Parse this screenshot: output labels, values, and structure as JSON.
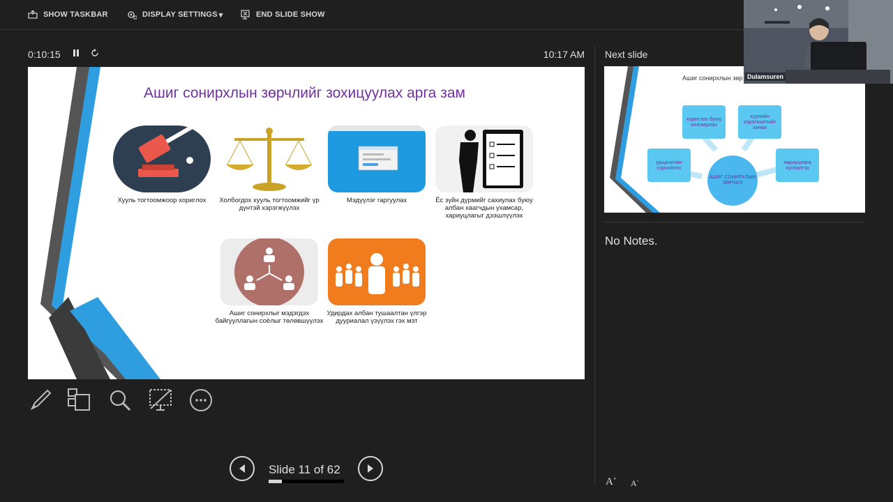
{
  "toolbar": {
    "show_taskbar": "SHOW TASKBAR",
    "display_settings": "DISPLAY SETTINGS",
    "display_settings_arrow": "▾",
    "end_slide_show": "END SLIDE SHOW"
  },
  "presenter": {
    "elapsed_time": "0:10:15",
    "clock": "10:17 AM",
    "next_slide_label": "Next slide",
    "notes": "No Notes.",
    "slide_counter": "Slide 11 of 62",
    "progress_fraction": 0.177,
    "font_increase": "A",
    "font_decrease": "A"
  },
  "current_slide": {
    "title": "Ашиг сонирхлын зөрчлийг зохицуулах арга зам",
    "items": [
      {
        "caption": "Хууль тогтоомжоор хориглох",
        "icon": "gavel-icon"
      },
      {
        "caption": "Холбогдох хууль тогтоомжийг үр дүнтэй хэрэгжүүлэх",
        "icon": "scales-icon"
      },
      {
        "caption": "Мэдүүлэг гаргуулах",
        "icon": "form-window-icon"
      },
      {
        "caption": "Ёс зүйн дүрмийг сахиулах буюу албан хаагчдын ухамсар, хариуцлагыг дээшлүүлэх",
        "icon": "checklist-icon"
      },
      {
        "caption": "Ашиг сонирхлыг мэдэгдэх байгууллагын соёлыг төлөвшүүлэх",
        "icon": "org-people-icon"
      },
      {
        "caption": "Удирдах албан тушаалтан үлгэр дууриалал үзүүлэх гэх мэт",
        "icon": "leader-group-icon"
      }
    ]
  },
  "next_slide": {
    "title": "Ашиг сонирхлын зөр",
    "center": "АШИГ СОНИРХЛЫН ЗӨРЧИЛ",
    "bubbles": [
      "хориглох буюу хязгаарлах",
      "хуулийн хэрэгжилтийг хянах",
      "урьдчилан сэргийлэх",
      "хариуцлага хүлээлгэх"
    ]
  },
  "video": {
    "participant": "Dulamsuren"
  },
  "colors": {
    "accent_purple": "#7030a0",
    "slide_blue": "#2e9ee0",
    "orange": "#f07c1e",
    "dark_navy": "#3a4a5c",
    "brown": "#b0706a"
  }
}
